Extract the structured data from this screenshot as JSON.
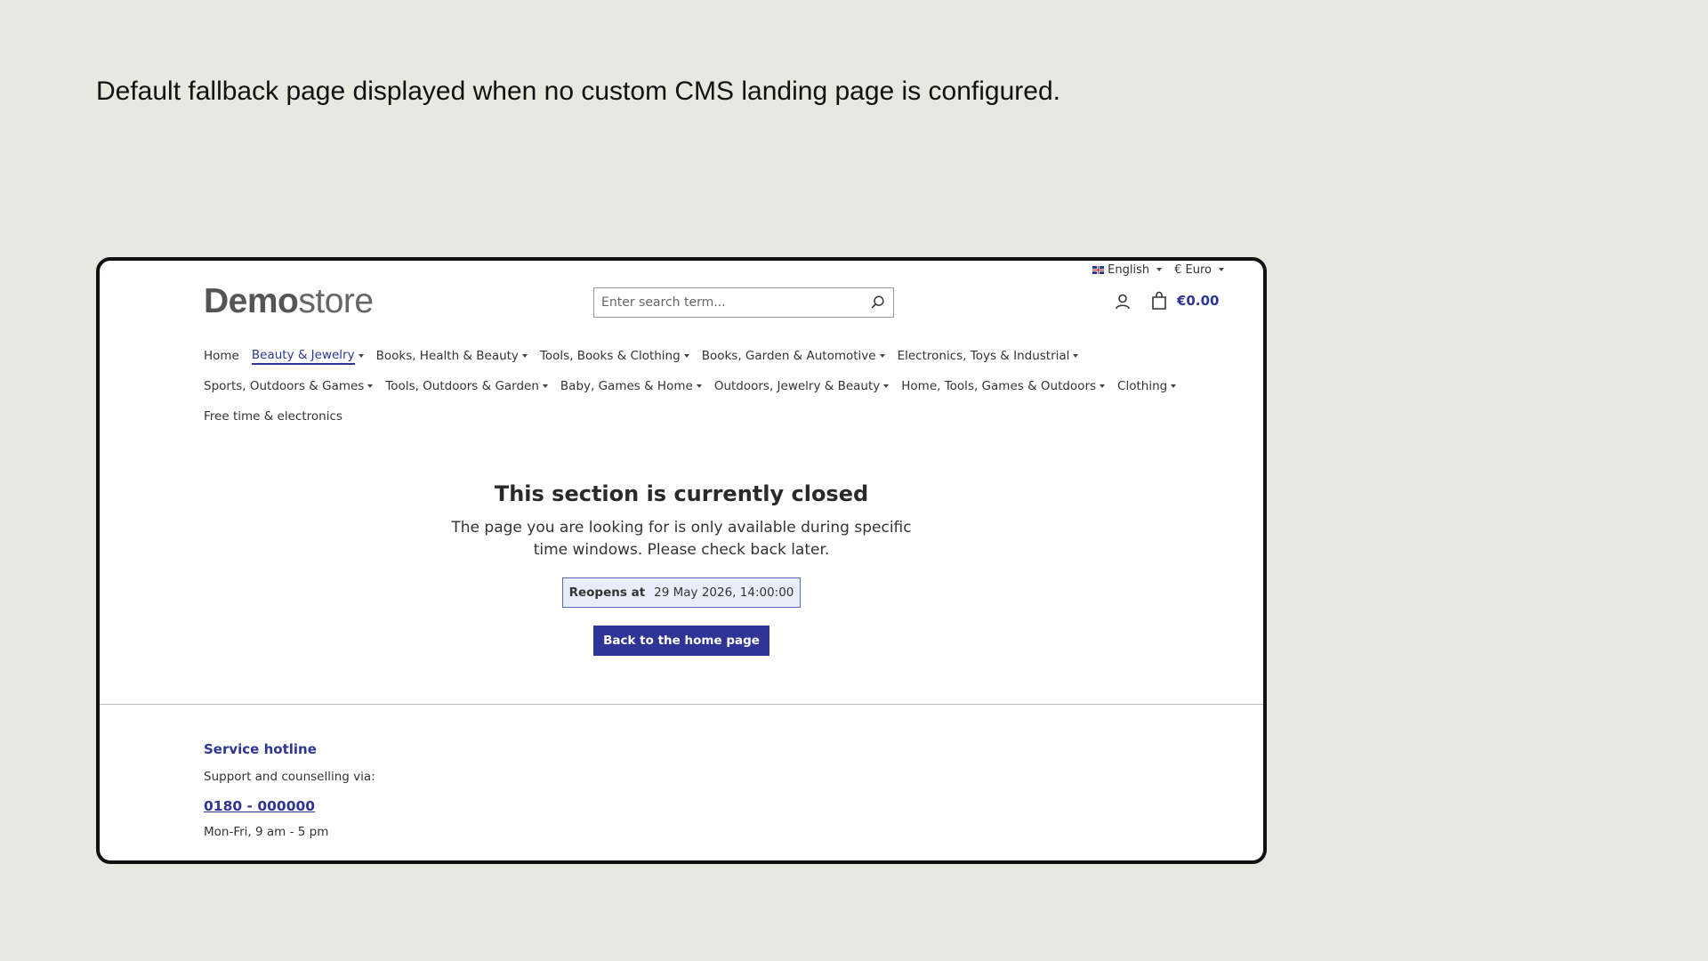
{
  "caption": "Default fallback page displayed when no custom CMS landing page is configured.",
  "topbar": {
    "language": "English",
    "currency": "€ Euro"
  },
  "logo": {
    "bold": "Demo",
    "light": "store"
  },
  "search": {
    "placeholder": "Enter search term..."
  },
  "cart": {
    "total": "€0.00"
  },
  "nav": {
    "row1": [
      {
        "label": "Home",
        "dropdown": false,
        "active": false
      },
      {
        "label": "Beauty & Jewelry",
        "dropdown": true,
        "active": true
      },
      {
        "label": "Books, Health & Beauty",
        "dropdown": true,
        "active": false
      },
      {
        "label": "Tools, Books & Clothing",
        "dropdown": true,
        "active": false
      },
      {
        "label": "Books, Garden & Automotive",
        "dropdown": true,
        "active": false
      },
      {
        "label": "Electronics, Toys & Industrial",
        "dropdown": true,
        "active": false
      }
    ],
    "row2": [
      {
        "label": "Sports, Outdoors & Games",
        "dropdown": true,
        "active": false
      },
      {
        "label": "Tools, Outdoors & Garden",
        "dropdown": true,
        "active": false
      },
      {
        "label": "Baby, Games & Home",
        "dropdown": true,
        "active": false
      },
      {
        "label": "Outdoors, Jewelry & Beauty",
        "dropdown": true,
        "active": false
      },
      {
        "label": "Home, Tools, Games & Outdoors",
        "dropdown": true,
        "active": false
      },
      {
        "label": "Clothing",
        "dropdown": true,
        "active": false
      }
    ],
    "row3": [
      {
        "label": "Free time & electronics",
        "dropdown": false,
        "active": false
      }
    ]
  },
  "main": {
    "title": "This section is currently closed",
    "description": "The page you are looking for is only available during specific time windows. Please check back later.",
    "reopen_label": "Reopens at",
    "reopen_value": "29 May 2026, 14:00:00",
    "back_button": "Back to the home page"
  },
  "footer": {
    "hotline_title": "Service hotline",
    "support_text": "Support and counselling via:",
    "phone": "0180 - 000000",
    "hours": "Mon-Fri, 9 am - 5 pm"
  },
  "colors": {
    "background": "#e7e8e0",
    "accent": "#2f3596",
    "reopen_bg": "#e8eef9"
  }
}
